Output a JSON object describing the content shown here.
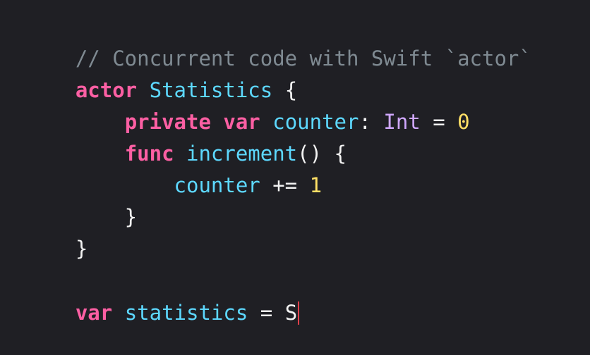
{
  "editor": {
    "lines": [
      [
        {
          "t": "// Concurrent code with Swift `actor`",
          "k": "comment"
        }
      ],
      [
        {
          "t": "actor",
          "k": "kw"
        },
        {
          "t": " ",
          "k": "plain"
        },
        {
          "t": "Statistics",
          "k": "ident"
        },
        {
          "t": " {",
          "k": "plain"
        }
      ],
      [
        {
          "t": "    ",
          "k": "plain"
        },
        {
          "t": "private",
          "k": "kw"
        },
        {
          "t": " ",
          "k": "plain"
        },
        {
          "t": "var",
          "k": "kw"
        },
        {
          "t": " ",
          "k": "plain"
        },
        {
          "t": "counter",
          "k": "ident"
        },
        {
          "t": ": ",
          "k": "plain"
        },
        {
          "t": "Int",
          "k": "builtin"
        },
        {
          "t": " = ",
          "k": "plain"
        },
        {
          "t": "0",
          "k": "num"
        }
      ],
      [
        {
          "t": "    ",
          "k": "plain"
        },
        {
          "t": "func",
          "k": "kw"
        },
        {
          "t": " ",
          "k": "plain"
        },
        {
          "t": "increment",
          "k": "ident"
        },
        {
          "t": "() {",
          "k": "plain"
        }
      ],
      [
        {
          "t": "        ",
          "k": "plain"
        },
        {
          "t": "counter",
          "k": "ident"
        },
        {
          "t": " += ",
          "k": "plain"
        },
        {
          "t": "1",
          "k": "num"
        }
      ],
      [
        {
          "t": "    }",
          "k": "plain"
        }
      ],
      [
        {
          "t": "}",
          "k": "plain"
        }
      ],
      [],
      [
        {
          "t": "var",
          "k": "kw"
        },
        {
          "t": " ",
          "k": "plain"
        },
        {
          "t": "statistics",
          "k": "ident"
        },
        {
          "t": " = ",
          "k": "plain"
        },
        {
          "t": "S",
          "k": "plain"
        }
      ]
    ],
    "cursor_line": 8
  },
  "colors": {
    "background": "#1f1f24",
    "comment": "#7f8a92",
    "keyword": "#fc5fa3",
    "identifier": "#5dd8ff",
    "type": "#d0a8ff",
    "number": "#ffe066",
    "plain": "#f2f2f2",
    "cursor": "#e0404a"
  }
}
